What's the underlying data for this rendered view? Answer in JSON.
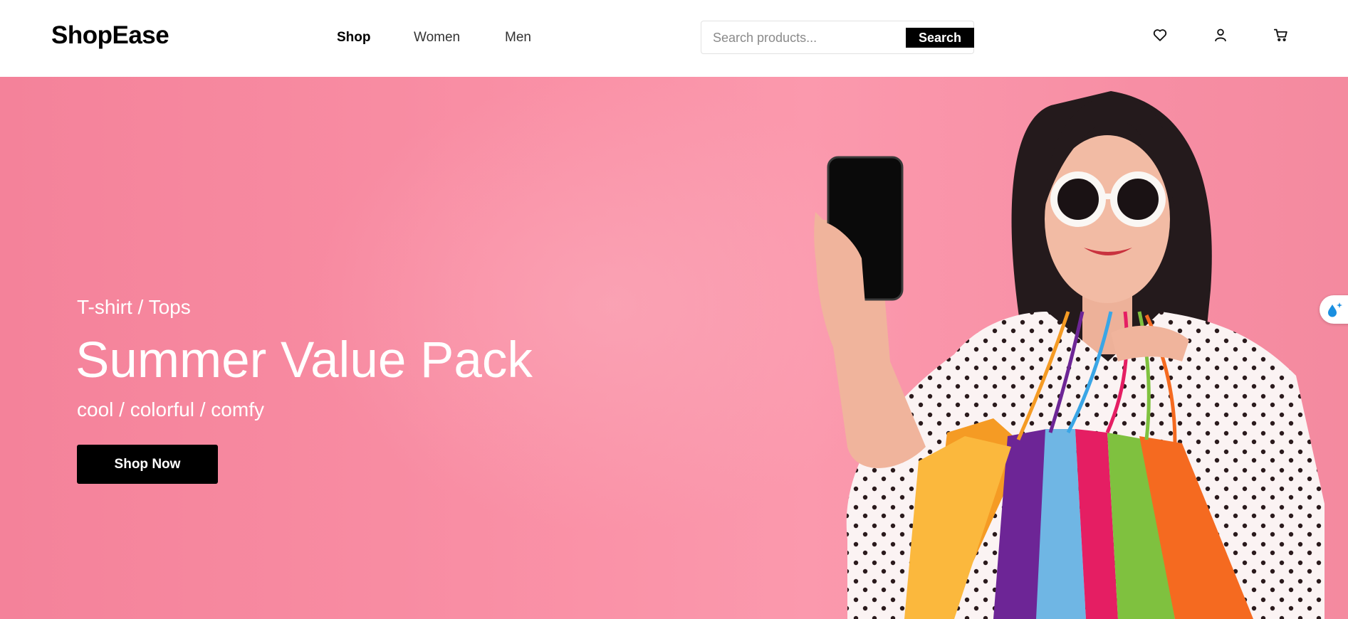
{
  "header": {
    "logo": "ShopEase",
    "nav": [
      {
        "label": "Shop",
        "active": true
      },
      {
        "label": "Women",
        "active": false
      },
      {
        "label": "Men",
        "active": false
      }
    ],
    "search": {
      "placeholder": "Search products...",
      "value": "",
      "button_label": "Search"
    },
    "icons": [
      "heart-icon",
      "user-icon",
      "cart-icon"
    ]
  },
  "hero": {
    "category": "T-shirt / Tops",
    "title": "Summer Value Pack",
    "tagline": "cool / colorful / comfy",
    "cta_label": "Shop Now",
    "background_color": "#f98ea4"
  },
  "floating_widget": {
    "icon": "sparkle-drop-icon",
    "accent": "#1a8fe0"
  },
  "colors": {
    "primary": "#000000",
    "hero_text": "#ffffff"
  }
}
